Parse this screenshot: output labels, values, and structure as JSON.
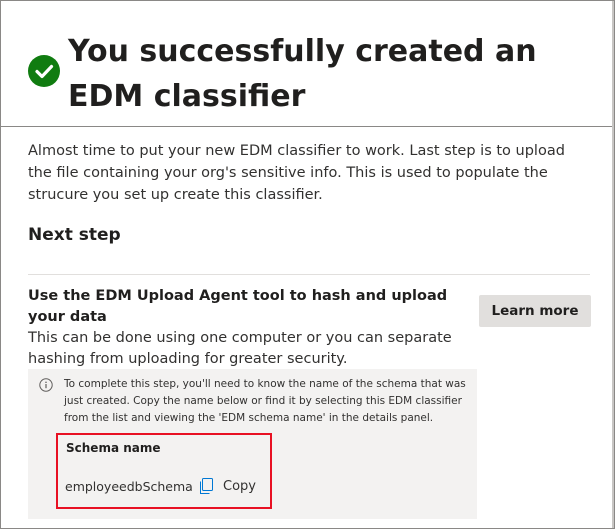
{
  "header": {
    "title": "You successfully created an EDM classifier",
    "success_icon": "checkmark-circle-icon"
  },
  "intro": {
    "description": "Almost time to put your new EDM classifier to work. Last step is to upload the file containing your org's sensitive info. This is used to populate the strucure you set up create this classifier."
  },
  "next_step": {
    "heading": "Next step",
    "step_title": "Use the EDM Upload Agent tool to hash and upload your data",
    "step_description": "This can be done using one computer or you can separate hashing from uploading for greater security.",
    "learn_more_label": "Learn more"
  },
  "info_panel": {
    "icon": "info-icon",
    "text": "To complete this step, you'll need to know the name of the schema that was just created. Copy the name below or find it by selecting this EDM classifier from the list and viewing the 'EDM schema name' in the details panel.",
    "schema_label": "Schema name",
    "schema_value": "employeedbSchema",
    "copy_label": "Copy",
    "copy_icon": "copy-icon"
  },
  "colors": {
    "success": "#107c10",
    "highlight_border": "#e81123",
    "button_bg": "#e1dfdd",
    "panel_bg": "#f3f2f1"
  }
}
